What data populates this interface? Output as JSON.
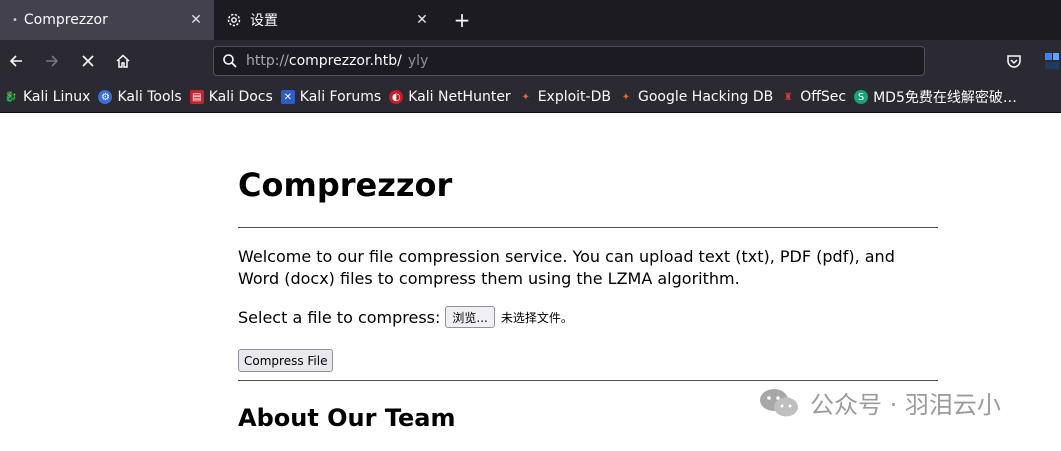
{
  "tabs": [
    {
      "label": "Comprezzor",
      "active": true
    },
    {
      "label": "设置",
      "active": false
    }
  ],
  "address_bar": {
    "protocol": "http://",
    "host": "comprezzor.htb/",
    "suffix": "yly"
  },
  "bookmarks": [
    {
      "label": "Kali Linux",
      "icon": "kali-dragon-icon"
    },
    {
      "label": "Kali Tools",
      "icon": "kali-tools-icon"
    },
    {
      "label": "Kali Docs",
      "icon": "kali-docs-icon"
    },
    {
      "label": "Kali Forums",
      "icon": "kali-forums-icon"
    },
    {
      "label": "Kali NetHunter",
      "icon": "nethunter-icon"
    },
    {
      "label": "Exploit-DB",
      "icon": "exploit-db-icon"
    },
    {
      "label": "Google Hacking DB",
      "icon": "ghdb-icon"
    },
    {
      "label": "OffSec",
      "icon": "offsec-icon"
    },
    {
      "label": "MD5免费在线解密破…",
      "icon": "md5-icon"
    }
  ],
  "page": {
    "title": "Comprezzor",
    "intro": "Welcome to our file compression service. You can upload text (txt), PDF (pdf), and Word (docx) files to compress them using the LZMA algorithm.",
    "upload_label": "Select a file to compress:",
    "browse_label": "浏览...",
    "no_file_text": "未选择文件。",
    "compress_button": "Compress File",
    "about_heading": "About Our Team"
  },
  "watermark": "公众号 · 羽泪云小"
}
